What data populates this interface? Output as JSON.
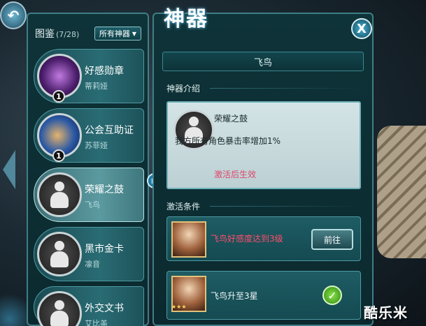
{
  "header": {
    "title": "神器",
    "back_icon": "back-arrow-icon",
    "close_label": "X"
  },
  "codex": {
    "title": "图鉴",
    "count": "(7/28)",
    "filter": "所有神器"
  },
  "items": [
    {
      "name": "好感勋章",
      "owner": "蒂莉娅",
      "badge": "1",
      "icon": "purple-staff-icon"
    },
    {
      "name": "公会互助证",
      "owner": "苏菲娅",
      "badge": "1",
      "icon": "scroll-icon"
    },
    {
      "name": "荣耀之鼓",
      "owner": "飞鸟",
      "icon": "silhouette-icon"
    },
    {
      "name": "黑市金卡",
      "owner": "凛音",
      "icon": "silhouette-icon"
    },
    {
      "name": "外交文书",
      "owner": "艾比盖",
      "icon": "silhouette-icon"
    }
  ],
  "detail": {
    "character": "飞鸟",
    "intro_label": "神器介绍",
    "artifact_name": "荣耀之鼓",
    "description": "我方所有角色暴击率增加1%",
    "status": "激活后生效",
    "conditions_label": "激活条件",
    "conditions": [
      {
        "text": "飞鸟好感度达到3级",
        "action": "前往",
        "done": false
      },
      {
        "text": "飞鸟升至3星",
        "done": true
      }
    ]
  },
  "watermark": "酷乐米",
  "colors": {
    "panel": "#0e3338",
    "accent_red": "#ff4d6b",
    "check_green": "#4cb81e"
  }
}
